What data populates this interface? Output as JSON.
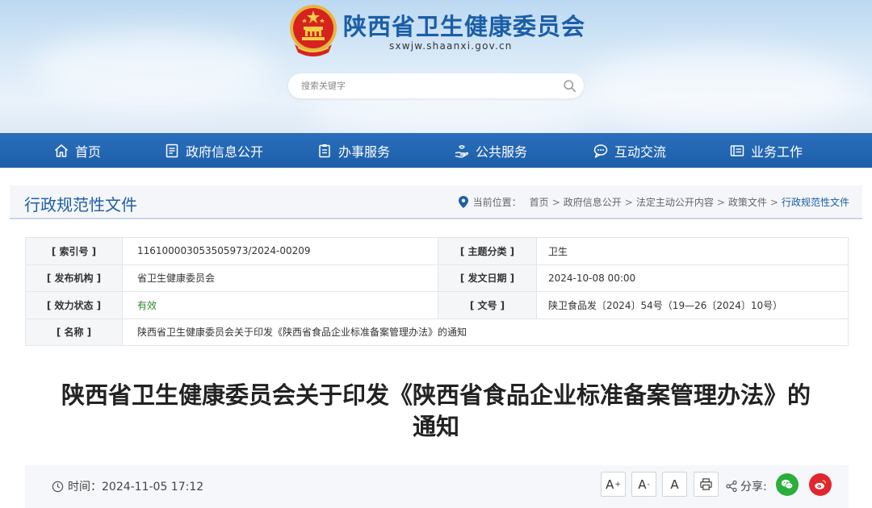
{
  "header": {
    "site_title": "陕西省卫生健康委员会",
    "site_domain": "sxwjw.shaanxi.gov.cn",
    "search_placeholder": "搜索关键字"
  },
  "nav": {
    "items": [
      {
        "label": "首页",
        "icon": "home-icon"
      },
      {
        "label": "政府信息公开",
        "icon": "document-icon"
      },
      {
        "label": "办事服务",
        "icon": "clipboard-icon"
      },
      {
        "label": "公共服务",
        "icon": "hand-service-icon"
      },
      {
        "label": "互动交流",
        "icon": "chat-icon"
      },
      {
        "label": "业务工作",
        "icon": "briefcase-icon"
      }
    ]
  },
  "section": {
    "title": "行政规范性文件",
    "breadcrumb_prefix": "当前位置：",
    "breadcrumb": [
      "首页",
      "政府信息公开",
      "法定主动公开内容",
      "政策文件",
      "行政规范性文件"
    ]
  },
  "meta": {
    "index_label": "[ 索引号 ]",
    "index_value": "116100003053505973/2024-00209",
    "subject_label": "[ 主题分类 ]",
    "subject_value": "卫生",
    "issuer_label": "[ 发布机构 ]",
    "issuer_value": "省卫生健康委员会",
    "date_label": "[ 发文日期 ]",
    "date_value": "2024-10-08 00:00",
    "status_label": "[ 效力状态 ]",
    "status_value": "有效",
    "docno_label": "[ 文号 ]",
    "docno_value": "陕卫食品发〔2024〕54号（19—26〔2024〕10号）",
    "name_label": "[ 名称 ]",
    "name_value": "陕西省卫生健康委员会关于印发《陕西省食品企业标准备案管理办法》的通知"
  },
  "article": {
    "title_line1": "陕西省卫生健康委员会关于印发《陕西省食品企业标准备案管理办法》的",
    "title_line2": "通知"
  },
  "info": {
    "time_label": "时间：2024-11-05 17:12",
    "font_large": "A",
    "font_large_sup": "+",
    "font_small": "A",
    "font_small_sup": "-",
    "font_default": "A",
    "share_label": "分享:"
  },
  "colors": {
    "brand_blue": "#1d5ea8",
    "nav_blue": "#2a6fbd",
    "valid_green": "#2d8a2d",
    "wechat_green": "#2aae3c",
    "weibo_red": "#e0262e"
  }
}
